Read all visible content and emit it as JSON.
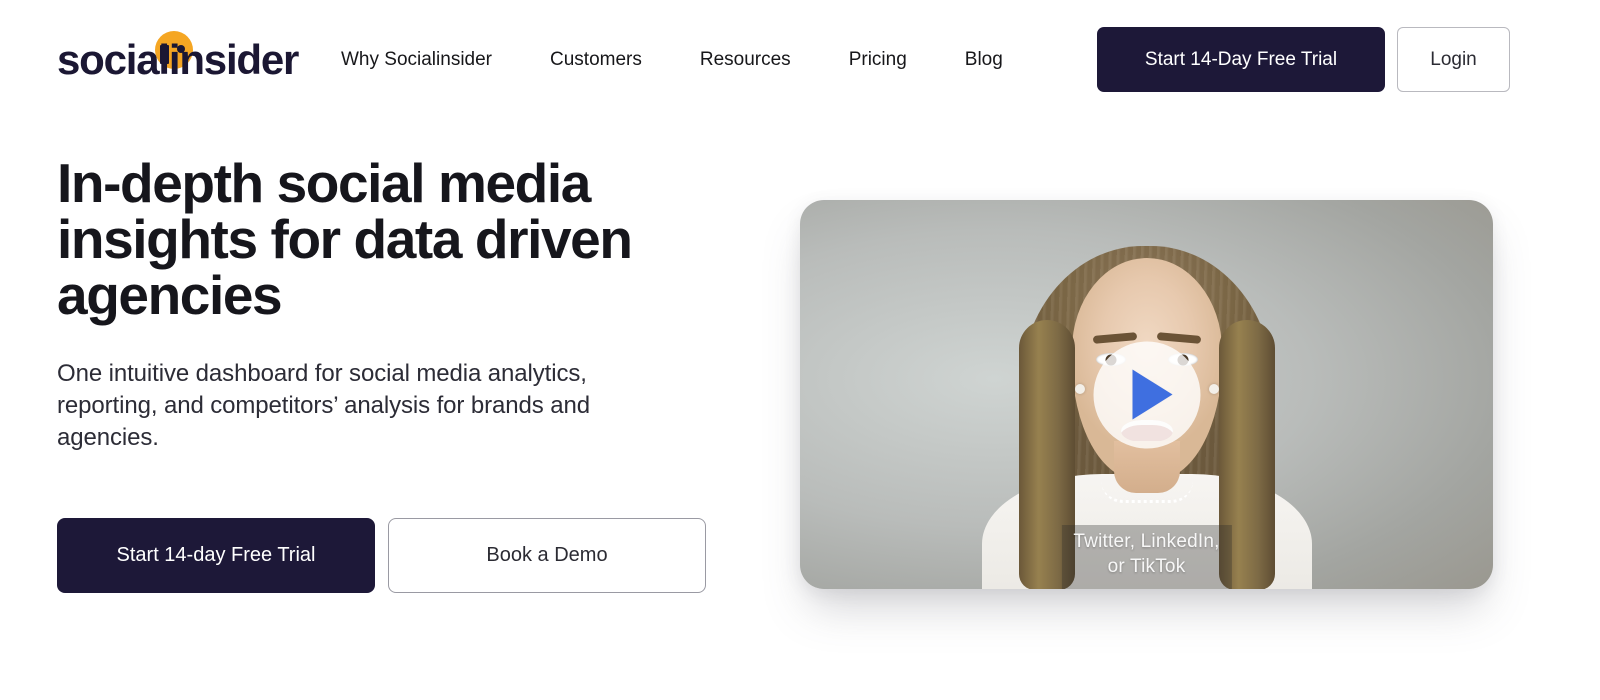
{
  "brand": {
    "logo_text": "socialinsider",
    "logo_accent_color": "#f5a623",
    "logo_text_color": "#1b1733"
  },
  "header": {
    "nav": [
      {
        "label": "Why Socialinsider"
      },
      {
        "label": "Customers"
      },
      {
        "label": "Resources"
      },
      {
        "label": "Pricing"
      },
      {
        "label": "Blog"
      }
    ],
    "trial_button": "Start 14-Day Free Trial",
    "login_button": "Login",
    "primary_color": "#1d1838"
  },
  "hero": {
    "title": "In-depth social media insights for data driven agencies",
    "subtitle": "One intuitive dashboard for social media analytics, reporting, and competitors’ analysis for brands and agencies.",
    "cta_primary": "Start 14-day Free Trial",
    "cta_secondary": "Book a Demo"
  },
  "video": {
    "play_icon": "play-triangle-icon",
    "play_icon_color": "#3f6fe0",
    "caption": "Twitter, LinkedIn,\nor TikTok"
  }
}
